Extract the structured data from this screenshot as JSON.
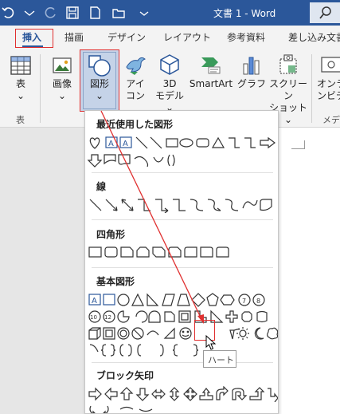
{
  "title_bar": {
    "doc_title": "文書 1 - Word",
    "quick_access_icons": [
      "undo-icon",
      "redo-icon",
      "save-icon",
      "folder-icon",
      "autosave-icon"
    ],
    "search_icon": "search-icon"
  },
  "tabs": [
    {
      "label": "挿入",
      "active": true
    },
    {
      "label": "描画"
    },
    {
      "label": "デザイン"
    },
    {
      "label": "レイアウト"
    },
    {
      "label": "参考資料"
    },
    {
      "label": "差し込み文書"
    }
  ],
  "ribbon": {
    "table": {
      "label": "表",
      "group": "表"
    },
    "images": {
      "label": "画像"
    },
    "shapes": {
      "label": "図形"
    },
    "icons": {
      "label1": "アイ",
      "label2": "コン"
    },
    "model3d": {
      "label1": "3D",
      "label2": "モデル"
    },
    "smartart": {
      "label": "SmartArt"
    },
    "graph": {
      "label": "グラフ"
    },
    "screenshot": {
      "label1": "スクリーン",
      "label2": "ショット"
    },
    "online_video": {
      "label1": "オンラ",
      "label2": "ンビデ"
    },
    "media_group": "メディ",
    "chevron": "⌄"
  },
  "shapes_menu": {
    "sections": [
      {
        "title": "最近使用した図形"
      },
      {
        "title": "線"
      },
      {
        "title": "四角形"
      },
      {
        "title": "基本図形"
      },
      {
        "title": "ブロック矢印"
      }
    ],
    "tooltip": "ハート"
  },
  "colors": {
    "accent_blue": "#2b579a",
    "highlight_red": "#e03030"
  }
}
